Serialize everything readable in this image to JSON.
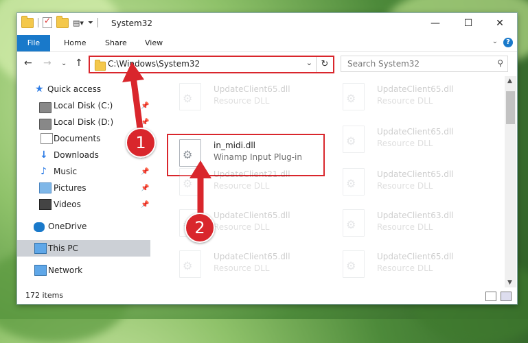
{
  "window": {
    "title": "System32"
  },
  "ribbon": {
    "tabs": [
      "File",
      "Home",
      "Share",
      "View"
    ]
  },
  "address": {
    "path": "C:\\Windows\\System32",
    "search_placeholder": "Search System32"
  },
  "navpane": {
    "items": [
      {
        "label": "Quick access",
        "icon": "star-icon"
      },
      {
        "label": "Local Disk (C:)",
        "icon": "drive-icon"
      },
      {
        "label": "Local Disk (D:)",
        "icon": "drive-icon"
      },
      {
        "label": "Documents",
        "icon": "documents-icon"
      },
      {
        "label": "Downloads",
        "icon": "download-icon"
      },
      {
        "label": "Music",
        "icon": "music-icon"
      },
      {
        "label": "Pictures",
        "icon": "pictures-icon"
      },
      {
        "label": "Videos",
        "icon": "videos-icon"
      },
      {
        "label": "OneDrive",
        "icon": "cloud-icon"
      },
      {
        "label": "This PC",
        "icon": "computer-icon"
      },
      {
        "label": "Network",
        "icon": "network-icon"
      }
    ]
  },
  "files": {
    "highlighted": {
      "name": "in_midi.dll",
      "description": "Winamp Input Plug-in"
    },
    "faded": [
      {
        "name": "UpdateClient65.dll",
        "description": "Resource DLL"
      },
      {
        "name": "UpdateClient65.dll",
        "description": "Resource DLL"
      },
      {
        "name": "UpdateClient65.dll",
        "description": "Resource DLL"
      },
      {
        "name": "UpdateClient21.dll",
        "description": "Resource DLL"
      },
      {
        "name": "UpdateClient65.dll",
        "description": "Resource DLL"
      },
      {
        "name": "UpdateClient65.dll",
        "description": "Resource DLL"
      },
      {
        "name": "UpdateClient63.dll",
        "description": "Resource DLL"
      },
      {
        "name": "UpdateClient65.dll",
        "description": "Resource DLL"
      },
      {
        "name": "UpdateClient65.dll",
        "description": "Resource DLL"
      }
    ]
  },
  "status": {
    "items": "172 items"
  },
  "annotations": {
    "badge1": "1",
    "badge2": "2",
    "color": "#d9262c"
  }
}
